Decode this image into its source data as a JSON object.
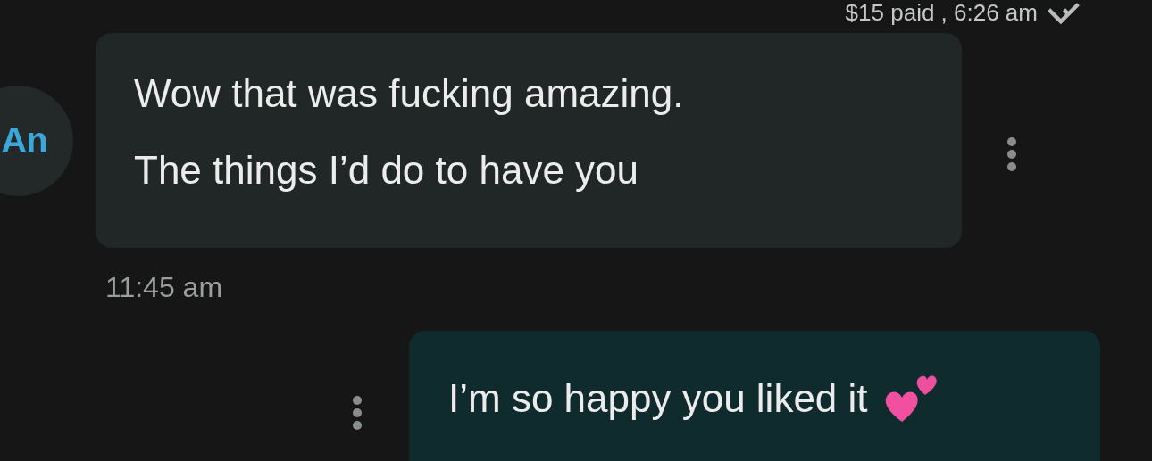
{
  "header": {
    "status": "$15 paid , 6:26 am"
  },
  "messages": [
    {
      "kind": "incoming",
      "sender_initials": "An",
      "lines": [
        "Wow that was fucking amazing.",
        "The things I’d do to have you"
      ],
      "time": "11:45 am"
    },
    {
      "kind": "outgoing",
      "text": "I’m so happy you liked it"
    }
  ]
}
